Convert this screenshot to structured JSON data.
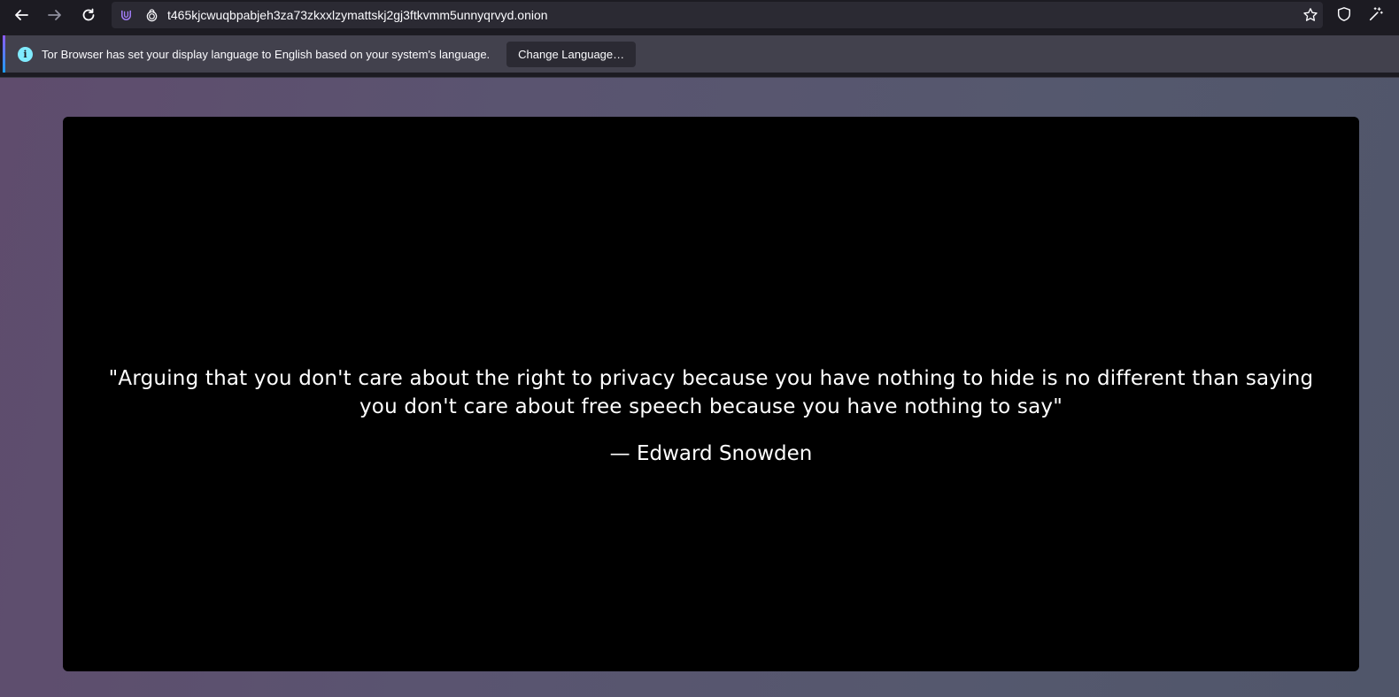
{
  "toolbar": {
    "back_icon": "arrow-left-icon",
    "forward_icon": "arrow-right-icon",
    "reload_icon": "reload-icon",
    "url": "t465kjcwuqbpabjeh3za73zkxxlzymattskj2gj3ftkvmm5unnyqrvyd.onion"
  },
  "notification": {
    "message": "Tor Browser has set your display language to English based on your system's language.",
    "button_label": "Change Language…"
  },
  "page": {
    "quote": "\"Arguing that you don't care about the right to privacy because you have nothing to hide is no different than saying you don't care about free speech because you have nothing to say\"",
    "author": "— Edward Snowden"
  },
  "colors": {
    "toolbar_bg": "#1c1b22",
    "urlbar_bg": "#2b2a33",
    "notification_bg": "#42414d",
    "info_accent": "#80ebff",
    "card_bg": "#000000",
    "text": "#fbfbfe"
  }
}
